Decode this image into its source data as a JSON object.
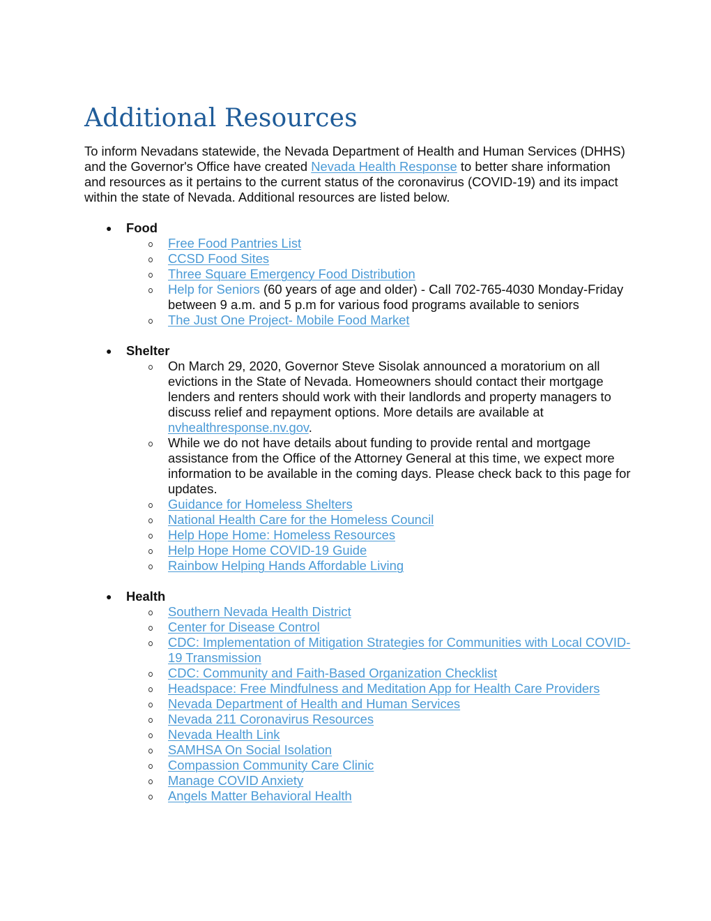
{
  "title": "Additional Resources",
  "intro": {
    "before_link": "To inform Nevadans statewide, the Nevada Department of Health and Human Services (DHHS) and the Governor's Office have created ",
    "link": "Nevada Health Response",
    "after_link": " to better share information and resources as it pertains to the current status of the coronavirus (COVID-19) and its impact within the state of Nevada. Additional resources are listed below."
  },
  "colors": {
    "heading": "#1f5c99",
    "link": "#4a9ad6",
    "text": "#111111"
  },
  "sections": [
    {
      "title": "Food",
      "items": [
        {
          "type": "link",
          "text": "Free Food Pantries List"
        },
        {
          "type": "link",
          "text": "CCSD Food Sites"
        },
        {
          "type": "link",
          "text": "Three Square Emergency Food Distribution"
        },
        {
          "type": "mixed",
          "link": "Help for Seniors",
          "after": " (60 years of age and older) - Call 702-765-4030 Monday-Friday between 9 a.m. and 5 p.m for various food programs available to seniors"
        },
        {
          "type": "link",
          "text": "The Just One Project- Mobile Food Market "
        }
      ]
    },
    {
      "title": "Shelter",
      "items": [
        {
          "type": "mixed-end",
          "before": "On March 29, 2020, Governor Steve Sisolak announced a moratorium on all evictions in the State of Nevada. Homeowners should contact their mortgage lenders and renters should work with their landlords and property managers to discuss relief and repayment options. More details are available at ",
          "link": "nvhealthresponse.nv.gov",
          "after": "."
        },
        {
          "type": "text",
          "text": "While we do not have details about funding to provide rental and mortgage assistance from the Office of the Attorney General at this time, we expect more information to be available in the coming days. Please check back to this page for updates."
        },
        {
          "type": "link",
          "text": "Guidance for Homeless Shelters "
        },
        {
          "type": "link",
          "text": "National Health Care for the Homeless Council "
        },
        {
          "type": "link",
          "text": "Help Hope Home: Homeless Resources"
        },
        {
          "type": "link",
          "text": "Help Hope Home COVID-19 Guide "
        },
        {
          "type": "link",
          "text": "Rainbow Helping Hands Affordable Living"
        }
      ]
    },
    {
      "title": "Health",
      "items": [
        {
          "type": "link",
          "text": "Southern Nevada Health District"
        },
        {
          "type": "link",
          "text": "Center for Disease Control "
        },
        {
          "type": "link",
          "text": "CDC: Implementation of Mitigation Strategies for Communities with Local COVID-19 Transmission"
        },
        {
          "type": "link",
          "text": "CDC: Community and Faith-Based Organization Checklist "
        },
        {
          "type": "link",
          "text": "Headspace: Free Mindfulness and Meditation App for Health Care Providers"
        },
        {
          "type": "link",
          "text": "Nevada Department of Health and Human Services"
        },
        {
          "type": "link",
          "text": "Nevada 211 Coronavirus Resources "
        },
        {
          "type": "link",
          "text": "Nevada Health Link "
        },
        {
          "type": "link",
          "text": "SAMHSA On Social Isolation "
        },
        {
          "type": "link",
          "text": "Compassion Community Care Clinic"
        },
        {
          "type": "link",
          "text": "Manage COVID Anxiety "
        },
        {
          "type": "link",
          "text": "Angels Matter Behavioral Health"
        }
      ]
    }
  ]
}
